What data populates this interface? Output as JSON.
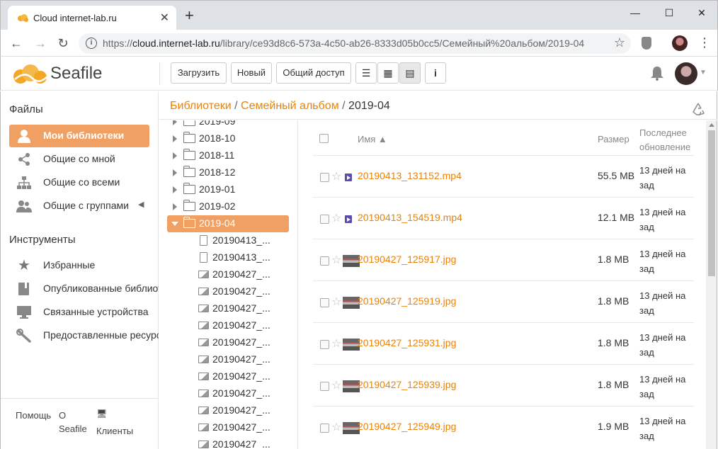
{
  "browser": {
    "tab_title": "Cloud internet-lab.ru",
    "tab_close": "✕",
    "new_tab": "+",
    "url_scheme": "https://",
    "url_host": "cloud.internet-lab.ru",
    "url_path": "/library/ce93d8c6-573a-4c50-ab26-8333d05b0cc5/Семейный%20альбом/2019-04",
    "window_controls": {
      "minimize": "—",
      "maximize": "☐",
      "close": "✕"
    }
  },
  "app": {
    "logo_text": "Seafile",
    "toolbar": {
      "upload": "Загрузить",
      "new": "Новый",
      "share": "Общий доступ",
      "info": "i"
    }
  },
  "sidebar": {
    "files_heading": "Файлы",
    "files": [
      {
        "label": "Мои библиотеки",
        "icon": "user-icon",
        "active": true
      },
      {
        "label": "Общие со мной",
        "icon": "share-icon",
        "active": false
      },
      {
        "label": "Общие со всеми",
        "icon": "org-icon",
        "active": false
      },
      {
        "label": "Общие с группами",
        "icon": "group-icon",
        "active": false
      }
    ],
    "tools_heading": "Инструменты",
    "tools": [
      {
        "label": "Избранные",
        "icon": "star-icon"
      },
      {
        "label": "Опубликованные библиотеки",
        "icon": "book-icon"
      },
      {
        "label": "Связанные устройства",
        "icon": "monitor-icon"
      },
      {
        "label": "Предоставленные ресурсы",
        "icon": "wrench-icon"
      }
    ],
    "footer": {
      "help": "Помощь",
      "about_o": "О",
      "about_seafile": "Seafile",
      "clients": "Клиенты"
    }
  },
  "breadcrumb": {
    "libraries": "Библиотеки",
    "sep": "/",
    "album": "Семейный альбом",
    "current": "2019-04"
  },
  "tree": {
    "folders": [
      "2019-09",
      "2018-10",
      "2018-11",
      "2018-12",
      "2019-01",
      "2019-02",
      "2019-04"
    ],
    "files": [
      {
        "label": "20190413_...",
        "kind": "file"
      },
      {
        "label": "20190413_...",
        "kind": "file"
      },
      {
        "label": "20190427_...",
        "kind": "image"
      },
      {
        "label": "20190427_...",
        "kind": "image"
      },
      {
        "label": "20190427_...",
        "kind": "image"
      },
      {
        "label": "20190427_...",
        "kind": "image"
      },
      {
        "label": "20190427_...",
        "kind": "image"
      },
      {
        "label": "20190427_...",
        "kind": "image"
      },
      {
        "label": "20190427_...",
        "kind": "image"
      },
      {
        "label": "20190427_...",
        "kind": "image"
      },
      {
        "label": "20190427_...",
        "kind": "image"
      },
      {
        "label": "20190427_...",
        "kind": "image"
      },
      {
        "label": "20190427_...",
        "kind": "image"
      }
    ]
  },
  "table": {
    "headers": {
      "name": "Имя ▲",
      "size": "Размер",
      "updated": "Последнее обновление"
    },
    "rows": [
      {
        "name": "20190413_131152.mp4",
        "size": "55.5 MB",
        "updated": "13 дней на зад",
        "kind": "video"
      },
      {
        "name": "20190413_154519.mp4",
        "size": "12.1 MB",
        "updated": "13 дней на зад",
        "kind": "video"
      },
      {
        "name": "20190427_125917.jpg",
        "size": "1.8 MB",
        "updated": "13 дней на зад",
        "kind": "image"
      },
      {
        "name": "20190427_125919.jpg",
        "size": "1.8 MB",
        "updated": "13 дней на зад",
        "kind": "image"
      },
      {
        "name": "20190427_125931.jpg",
        "size": "1.8 MB",
        "updated": "13 дней на зад",
        "kind": "image"
      },
      {
        "name": "20190427_125939.jpg",
        "size": "1.8 MB",
        "updated": "13 дней на зад",
        "kind": "image"
      },
      {
        "name": "20190427_125949.jpg",
        "size": "1.9 MB",
        "updated": "13 дней на зад",
        "kind": "image"
      }
    ]
  },
  "colors": {
    "accent": "#f0a062",
    "link": "#eb8205"
  }
}
